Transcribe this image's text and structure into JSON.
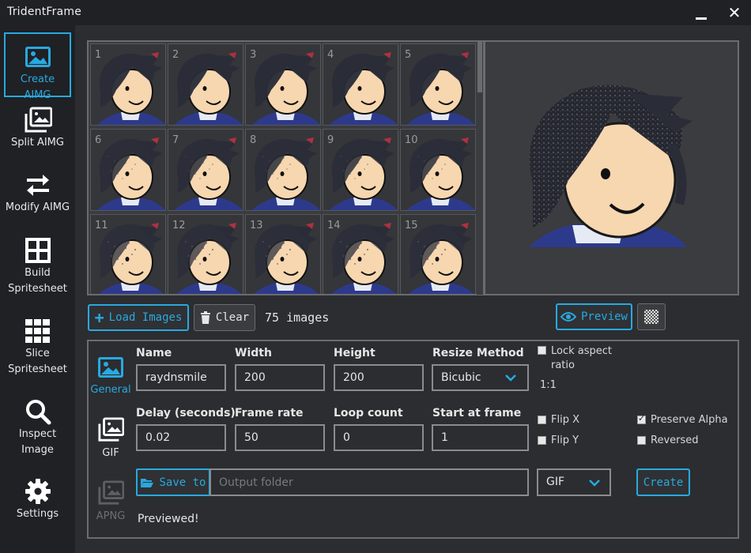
{
  "window": {
    "title": "TridentFrame"
  },
  "sidebar": {
    "items": [
      {
        "label": "Create AIMG",
        "icon": "image-icon"
      },
      {
        "label": "Split AIMG",
        "icon": "images-icon"
      },
      {
        "label": "Modify AIMG",
        "icon": "swap-arrows-icon"
      },
      {
        "label": "Build Spritesheet",
        "icon": "grid-icon"
      },
      {
        "label": "Slice Spritesheet",
        "icon": "grid-dots-icon"
      },
      {
        "label": "Inspect Image",
        "icon": "search-icon"
      },
      {
        "label": "Settings",
        "icon": "gear-icon"
      }
    ]
  },
  "frames": {
    "labels": [
      "1",
      "2",
      "3",
      "4",
      "5",
      "6",
      "7",
      "8",
      "9",
      "10",
      "11",
      "12",
      "13",
      "14",
      "15"
    ]
  },
  "toolbar": {
    "load_label": "Load Images",
    "clear_label": "Clear",
    "count_text": "75 images",
    "preview_label": "Preview"
  },
  "settings": {
    "tabs": [
      {
        "label": "General",
        "active": true
      },
      {
        "label": "GIF",
        "active": false
      },
      {
        "label": "APNG",
        "active": false
      }
    ],
    "name_label": "Name",
    "name_value": "raydnsmile",
    "width_label": "Width",
    "width_value": "200",
    "height_label": "Height",
    "height_value": "200",
    "resize_label": "Resize Method",
    "resize_value": "Bicubic",
    "lock_aspect_label": "Lock aspect ratio",
    "aspect_value": "1:1",
    "delay_label": "Delay (seconds)",
    "delay_value": "0.02",
    "framerate_label": "Frame rate",
    "framerate_value": "50",
    "loop_label": "Loop count",
    "loop_value": "0",
    "start_label": "Start at frame",
    "start_value": "1",
    "flip_x_label": "Flip X",
    "flip_y_label": "Flip Y",
    "preserve_alpha_label": "Preserve Alpha",
    "reversed_label": "Reversed",
    "save_to_label": "Save to",
    "output_placeholder": "Output folder",
    "format_value": "GIF",
    "create_label": "Create",
    "status_text": "Previewed!"
  },
  "colors": {
    "accent": "#29a9e0",
    "background": "#2b2d30",
    "sidebar": "#1f2124"
  }
}
